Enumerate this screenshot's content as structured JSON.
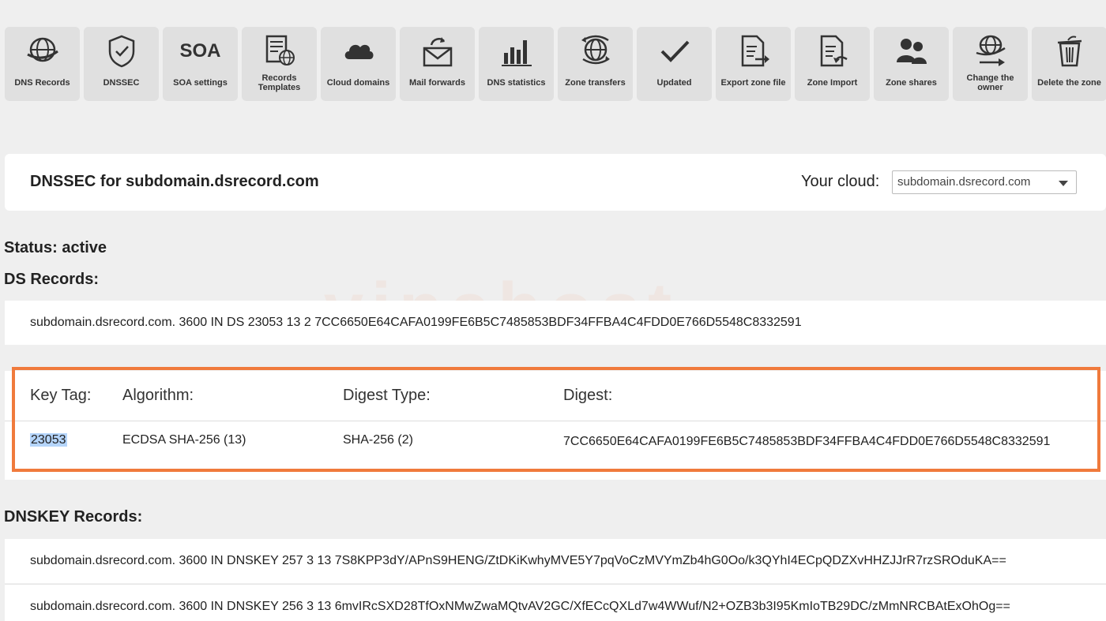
{
  "toolbar": [
    {
      "name": "dns-records",
      "label": "DNS Records",
      "icon": "globe-icon"
    },
    {
      "name": "dnssec",
      "label": "DNSSEC",
      "icon": "shield-check-icon"
    },
    {
      "name": "soa-settings",
      "label": "SOA settings",
      "icon": "soa-text-icon",
      "icon_text": "SOA"
    },
    {
      "name": "records-templates",
      "label": "Records Templates",
      "icon": "template-icon"
    },
    {
      "name": "cloud-domains",
      "label": "Cloud domains",
      "icon": "cloud-icon"
    },
    {
      "name": "mail-forwards",
      "label": "Mail forwards",
      "icon": "mail-forward-icon"
    },
    {
      "name": "dns-statistics",
      "label": "DNS statistics",
      "icon": "bar-chart-icon"
    },
    {
      "name": "zone-transfers",
      "label": "Zone transfers",
      "icon": "globe-transfer-icon"
    },
    {
      "name": "updated",
      "label": "Updated",
      "icon": "checkmark-icon"
    },
    {
      "name": "export-zone-file",
      "label": "Export zone file",
      "icon": "export-file-icon"
    },
    {
      "name": "zone-import",
      "label": "Zone Import",
      "icon": "import-file-icon"
    },
    {
      "name": "zone-shares",
      "label": "Zone shares",
      "icon": "users-icon"
    },
    {
      "name": "change-owner",
      "label": "Change the owner",
      "icon": "globe-arrow-icon"
    },
    {
      "name": "delete-zone",
      "label": "Delete the zone",
      "icon": "trash-icon"
    }
  ],
  "header": {
    "title": "DNSSEC for subdomain.dsrecord.com",
    "cloud_label": "Your cloud:",
    "cloud_selected": "subdomain.dsrecord.com"
  },
  "status": "Status: active",
  "ds_section_label": "DS Records:",
  "ds_record": "subdomain.dsrecord.com. 3600 IN DS 23053 13 2 7CC6650E64CAFA0199FE6B5C7485853BDF34FFBA4C4FDD0E766D5548C8332591",
  "ds_table": {
    "headers": {
      "key_tag": "Key Tag:",
      "algorithm": "Algorithm:",
      "digest_type": "Digest Type:",
      "digest": "Digest:"
    },
    "row": {
      "key_tag": "23053",
      "algorithm": "ECDSA SHA-256 (13)",
      "digest_type": "SHA-256 (2)",
      "digest": "7CC6650E64CAFA0199FE6B5C7485853BDF34FFBA4C4FDD0E766D5548C8332591"
    }
  },
  "dnskey_section_label": "DNSKEY Records:",
  "dnskey_records": [
    "subdomain.dsrecord.com. 3600 IN DNSKEY 257 3 13 7S8KPP3dY/APnS9HENG/ZtDKiKwhyMVE5Y7pqVoCzMVYmZb4hG0Oo/k3QYhI4ECpQDZXvHHZJJrR7rzSROduKA==",
    "subdomain.dsrecord.com. 3600 IN DNSKEY 256 3 13 6mvIRcSXD28TfOxNMwZwaMQtvAV2GC/XfECcQXLd7w4WWuf/N2+OZB3b3I95KmIoTB29DC/zMmNRCBAtExOhOg=="
  ],
  "colors": {
    "highlight_border": "#f07a3c",
    "selection": "#b5d5fb",
    "toolbar_bg": "#e0e0e0"
  }
}
